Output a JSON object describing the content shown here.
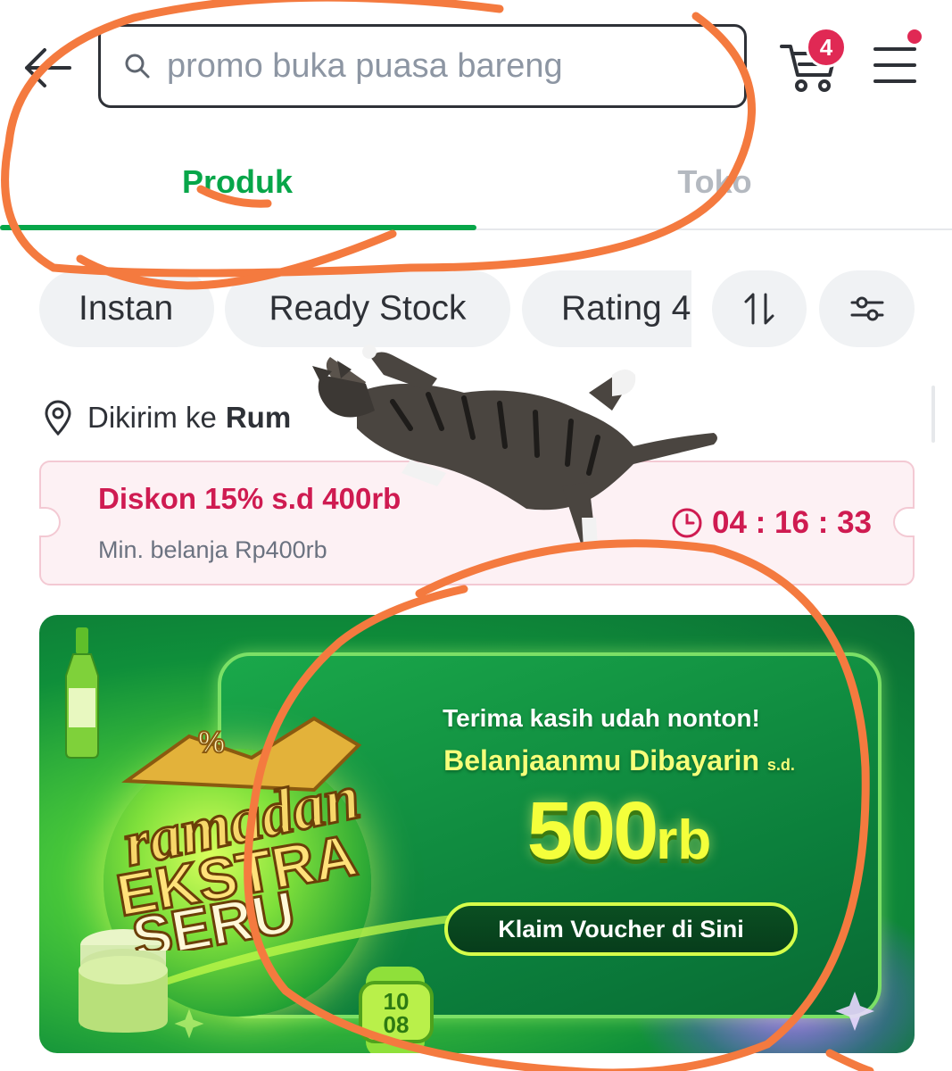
{
  "header": {
    "search_placeholder": "promo buka puasa bareng",
    "cart_count": "4"
  },
  "tabs": [
    {
      "label": "Produk",
      "active": true
    },
    {
      "label": "Toko",
      "active": false
    }
  ],
  "filters": [
    {
      "label": "Instan"
    },
    {
      "label": "Ready Stock"
    },
    {
      "label": "Rating 4"
    }
  ],
  "location": {
    "prefix": "Dikirim ke",
    "name": "Rum"
  },
  "voucher": {
    "title": "Diskon 15% s.d 400rb",
    "subtitle": "Min. belanja Rp400rb",
    "countdown": "04 : 16 : 33"
  },
  "banner": {
    "logo_text": [
      "ramadan",
      "EKSTRA",
      "SERU"
    ],
    "line1": "Terima kasih udah nonton!",
    "line2": "Belanjaanmu Dibayarin",
    "line2_suffix": "s.d.",
    "amount": "500",
    "amount_unit": "rb",
    "cta": "Klaim Voucher di Sini",
    "watch_text": "10 08"
  },
  "colors": {
    "brand_green": "#07a649",
    "promo_red": "#cf1b51",
    "badge_red": "#e02954",
    "annotation_orange": "#f47a3f"
  }
}
